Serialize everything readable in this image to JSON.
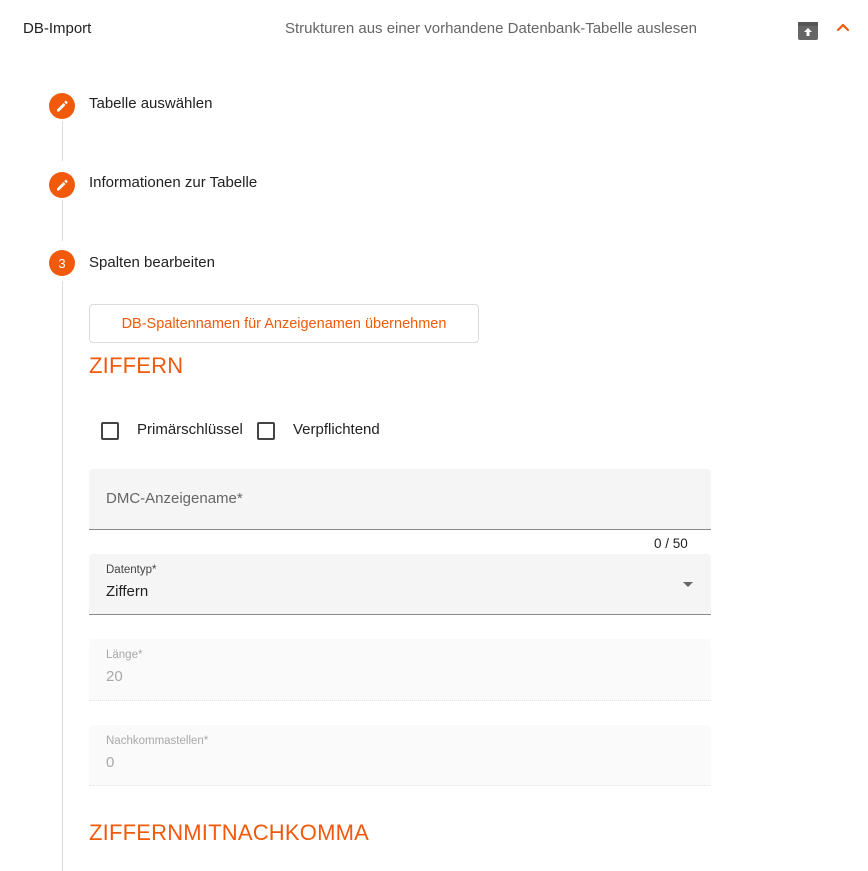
{
  "header": {
    "title": "DB-Import",
    "description": "Strukturen aus einer vorhandene Datenbank-Tabelle auslesen",
    "archive_icon": "archive-icon",
    "collapse_icon": "chevron-up-icon",
    "accent_color": "#f05a0a"
  },
  "steps": [
    {
      "label": "Tabelle auswählen",
      "state": "edit",
      "icon": "pencil-icon"
    },
    {
      "label": "Informationen zur Tabelle",
      "state": "edit",
      "icon": "pencil-icon"
    },
    {
      "label": "Spalten bearbeiten",
      "state": "active",
      "number": "3"
    }
  ],
  "actions": {
    "copy_names_button": "DB-Spaltennamen für Anzeigenamen übernehmen"
  },
  "sections": {
    "first_title": "ZIFFERN",
    "second_title": "ZIFFERNMITNACHKOMMA"
  },
  "checkboxes": {
    "primary_key": {
      "label": "Primärschlüssel",
      "checked": false
    },
    "required": {
      "label": "Verpflichtend",
      "checked": false
    }
  },
  "fields": {
    "display_name": {
      "placeholder": "DMC-Anzeigename*",
      "value": "",
      "counter": "0 / 50"
    },
    "data_type": {
      "label": "Datentyp*",
      "value": "Ziffern"
    },
    "length": {
      "label": "Länge*",
      "value": "20"
    },
    "decimals": {
      "label": "Nachkommastellen*",
      "value": "0"
    }
  }
}
